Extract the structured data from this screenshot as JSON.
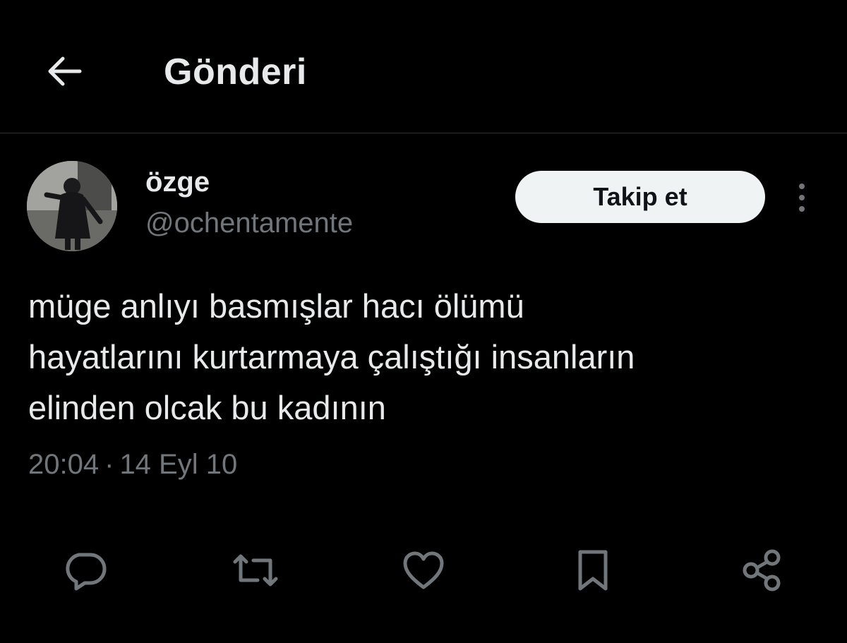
{
  "header": {
    "title": "Gönderi",
    "back_icon": "arrow-left-icon"
  },
  "author": {
    "display_name": "özge",
    "handle": "@ochentamente",
    "follow_label": "Takip et",
    "more_icon": "more-vertical-icon"
  },
  "tweet": {
    "text": "müge anlıyı basmışlar hacı ölümü\nhayatlarını kurtarmaya çalıştığı insanların\nelinden olcak bu kadının",
    "time": "20:04",
    "separator": "·",
    "date": "14 Eyl 10"
  },
  "actions": [
    {
      "icon": "reply-icon"
    },
    {
      "icon": "retweet-icon"
    },
    {
      "icon": "like-icon"
    },
    {
      "icon": "bookmark-icon"
    },
    {
      "icon": "share-icon"
    }
  ],
  "colors": {
    "background": "#000000",
    "primary_text": "#e7e9ea",
    "secondary_text": "#71767b",
    "divider": "#2f3336",
    "follow_button_bg": "#eff3f4",
    "follow_button_text": "#0f1419"
  }
}
